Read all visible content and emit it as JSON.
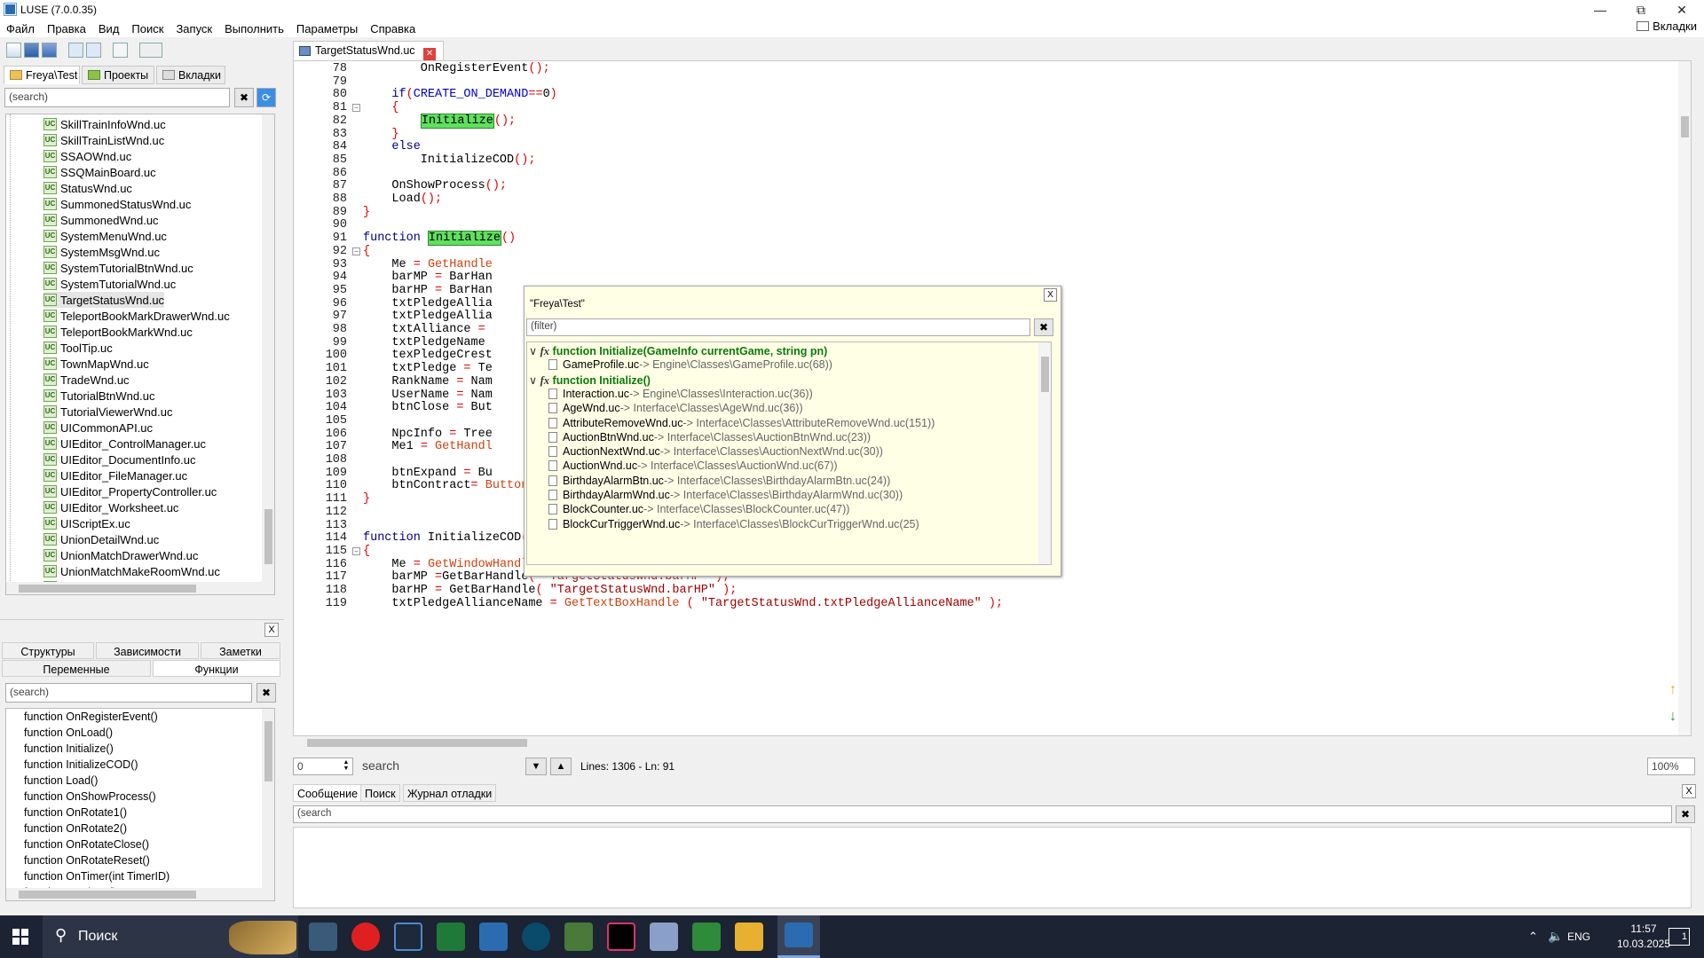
{
  "window": {
    "title": "LUSE (7.0.0.35)",
    "tabs_button": "Вкладки"
  },
  "menu": [
    "Файл",
    "Правка",
    "Вид",
    "Поиск",
    "Запуск",
    "Выполнить",
    "Параметры",
    "Справка"
  ],
  "nav_tabs": [
    "Freya\\Test",
    "Проекты",
    "Вкладки"
  ],
  "file_search": {
    "placeholder": "(search)"
  },
  "file_tree": {
    "selected": "TargetStatusWnd.uc",
    "items": [
      "SkillTrainInfoWnd.uc",
      "SkillTrainListWnd.uc",
      "SSAOWnd.uc",
      "SSQMainBoard.uc",
      "StatusWnd.uc",
      "SummonedStatusWnd.uc",
      "SummonedWnd.uc",
      "SystemMenuWnd.uc",
      "SystemMsgWnd.uc",
      "SystemTutorialBtnWnd.uc",
      "SystemTutorialWnd.uc",
      "TargetStatusWnd.uc",
      "TeleportBookMarkDrawerWnd.uc",
      "TeleportBookMarkWnd.uc",
      "ToolTip.uc",
      "TownMapWnd.uc",
      "TradeWnd.uc",
      "TutorialBtnWnd.uc",
      "TutorialViewerWnd.uc",
      "UICommonAPI.uc",
      "UIEditor_ControlManager.uc",
      "UIEditor_DocumentInfo.uc",
      "UIEditor_FileManager.uc",
      "UIEditor_PropertyController.uc",
      "UIEditor_Worksheet.uc",
      "UIScriptEx.uc",
      "UnionDetailWnd.uc",
      "UnionMatchDrawerWnd.uc",
      "UnionMatchMakeRoomWnd.uc",
      "UnionMatchWnd.uc"
    ]
  },
  "panel": {
    "close": "X",
    "tabs_row1": [
      "Структуры",
      "Зависимости",
      "Заметки"
    ],
    "tabs_row2": [
      "Переменные",
      "Функции"
    ],
    "search_placeholder": "(search)",
    "functions": [
      "function OnRegisterEvent()",
      "function OnLoad()",
      "function Initialize()",
      "function InitializeCOD()",
      "function Load()",
      "function OnShowProcess()",
      "function OnRotate1()",
      "function OnRotate2()",
      "function OnRotateClose()",
      "function OnRotateReset()",
      "function OnTimer(int TimerID)",
      "function OnShow()"
    ]
  },
  "editor": {
    "tab_name": "TargetStatusWnd.uc",
    "lines": [
      {
        "n": "78",
        "t": "        OnRegisterEvent();"
      },
      {
        "n": "79",
        "t": ""
      },
      {
        "n": "80",
        "t": "    if(CREATE_ON_DEMAND==0)"
      },
      {
        "n": "81",
        "t": "    {"
      },
      {
        "n": "82",
        "t": "        Initialize();"
      },
      {
        "n": "83",
        "t": "    }"
      },
      {
        "n": "84",
        "t": "    else"
      },
      {
        "n": "85",
        "t": "        InitializeCOD();"
      },
      {
        "n": "86",
        "t": ""
      },
      {
        "n": "87",
        "t": "    OnShowProcess();"
      },
      {
        "n": "88",
        "t": "    Load();"
      },
      {
        "n": "89",
        "t": "}"
      },
      {
        "n": "90",
        "t": ""
      },
      {
        "n": "91",
        "t": "function Initialize()"
      },
      {
        "n": "92",
        "t": "{"
      },
      {
        "n": "93",
        "t": "    Me = GetHandle"
      },
      {
        "n": "94",
        "t": "    barMP = BarHan"
      },
      {
        "n": "95",
        "t": "    barHP = BarHan"
      },
      {
        "n": "96",
        "t": "    txtPledgeAllia                                                   anceName\" ) );"
      },
      {
        "n": "97",
        "t": "    txtPledgeAllia                                                   anceCrest\" ) );"
      },
      {
        "n": "98",
        "t": "    txtAlliance ="
      },
      {
        "n": "99",
        "t": "    txtPledgeName"
      },
      {
        "n": "100",
        "t": "    texPledgeCrest"
      },
      {
        "n": "101",
        "t": "    txtPledge = Te"
      },
      {
        "n": "102",
        "t": "    RankName = Nam"
      },
      {
        "n": "103",
        "t": "    UserName = Nam"
      },
      {
        "n": "104",
        "t": "    btnClose = But"
      },
      {
        "n": "105",
        "t": ""
      },
      {
        "n": "106",
        "t": "    NpcInfo = Tree"
      },
      {
        "n": "107",
        "t": "    Me1 = GetHandl"
      },
      {
        "n": "108",
        "t": ""
      },
      {
        "n": "109",
        "t": "    btnExpand = Bu"
      },
      {
        "n": "110",
        "t": "    btnContract= ButtonHandle ( GetHandle( \"TargetStatusWnd.btnContract\" ) );;"
      },
      {
        "n": "111",
        "t": "}"
      },
      {
        "n": "112",
        "t": ""
      },
      {
        "n": "113",
        "t": ""
      },
      {
        "n": "114",
        "t": "function InitializeCOD()"
      },
      {
        "n": "115",
        "t": "{"
      },
      {
        "n": "116",
        "t": "    Me = GetWindowHandle( \"TargetStatusWnd\" );"
      },
      {
        "n": "117",
        "t": "    barMP =GetBarHandle( \"TargetStatusWnd.barMP\" );"
      },
      {
        "n": "118",
        "t": "    barHP = GetBarHandle( \"TargetStatusWnd.barHP\" );"
      },
      {
        "n": "119",
        "t": "    txtPledgeAllianceName = GetTextBoxHandle ( \"TargetStatusWnd.txtPledgeAllianceName\" );"
      }
    ]
  },
  "popup": {
    "title": "\"Freya\\Test\"",
    "close": "X",
    "filter_placeholder": "(filter)",
    "groups": [
      {
        "header": "function Initialize(GameInfo currentGame, string pn)",
        "items": [
          {
            "name": "GameProfile.uc",
            "path": "-> Engine\\Classes\\GameProfile.uc(68))"
          }
        ]
      },
      {
        "header": "function Initialize()",
        "items": [
          {
            "name": "Interaction.uc",
            "path": "-> Engine\\Classes\\Interaction.uc(36))"
          },
          {
            "name": "AgeWnd.uc",
            "path": "-> Interface\\Classes\\AgeWnd.uc(36))"
          },
          {
            "name": "AttributeRemoveWnd.uc",
            "path": "-> Interface\\Classes\\AttributeRemoveWnd.uc(151))"
          },
          {
            "name": "AuctionBtnWnd.uc",
            "path": "-> Interface\\Classes\\AuctionBtnWnd.uc(23))"
          },
          {
            "name": "AuctionNextWnd.uc",
            "path": "-> Interface\\Classes\\AuctionNextWnd.uc(30))"
          },
          {
            "name": "AuctionWnd.uc",
            "path": "-> Interface\\Classes\\AuctionWnd.uc(67))"
          },
          {
            "name": "BirthdayAlarmBtn.uc",
            "path": "-> Interface\\Classes\\BirthdayAlarmBtn.uc(24))"
          },
          {
            "name": "BirthdayAlarmWnd.uc",
            "path": "-> Interface\\Classes\\BirthdayAlarmWnd.uc(30))"
          },
          {
            "name": "BlockCounter.uc",
            "path": "-> Interface\\Classes\\BlockCounter.uc(47))"
          },
          {
            "name": "BlockCurTriggerWnd.uc",
            "path": "-> Interface\\Classes\\BlockCurTriggerWnd.uc(25)"
          }
        ]
      }
    ]
  },
  "statusbar": {
    "line_input": "0",
    "search_placeholder": "search",
    "info": "Lines: 1306 - Ln: 91",
    "zoom": "100%"
  },
  "bottom": {
    "tabs": [
      "Сообщение",
      "Поиск",
      "Журнал отладки"
    ],
    "search_placeholder": "(search",
    "close": "X"
  },
  "taskbar": {
    "search_label": "Поиск",
    "lang": "ENG",
    "time": "11:57",
    "date": "10.03.2025",
    "notif": "1"
  },
  "colors": {
    "keyword": "#00008b",
    "function_call": "#d04010",
    "string": "#a00000",
    "highlight": "#5fe05f",
    "popup_bg": "#ffffe6",
    "taskbar": "#1c2333"
  }
}
